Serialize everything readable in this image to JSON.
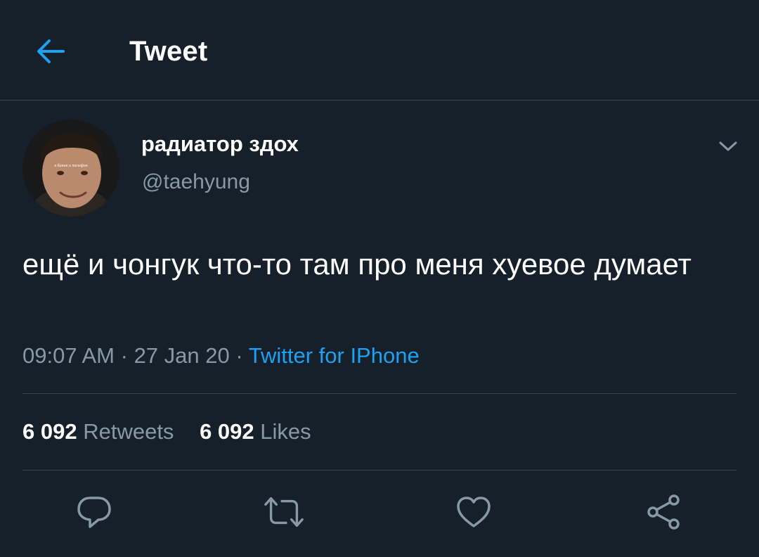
{
  "header": {
    "back_icon": "arrow-left-icon",
    "title": "Tweet"
  },
  "tweet": {
    "author": {
      "display_name": "радиатор здох",
      "handle": "@taehyung",
      "avatar_caption": "я банан и телефон"
    },
    "text": "ещё и чонгук что-то там про меня хуевое думает",
    "time": "09:07 AM",
    "separator": "·",
    "date": "27 Jan 20",
    "source": "Twitter for IPhone",
    "stats": {
      "retweets_count": "6 092",
      "retweets_label": "Retweets",
      "likes_count": "6 092",
      "likes_label": "Likes"
    },
    "actions": [
      {
        "icon": "reply-icon"
      },
      {
        "icon": "retweet-icon"
      },
      {
        "icon": "heart-icon"
      },
      {
        "icon": "share-icon"
      }
    ]
  },
  "colors": {
    "background": "#15202b",
    "divider": "#38444d",
    "secondary_text": "#8899a6",
    "accent": "#1da1f2"
  }
}
